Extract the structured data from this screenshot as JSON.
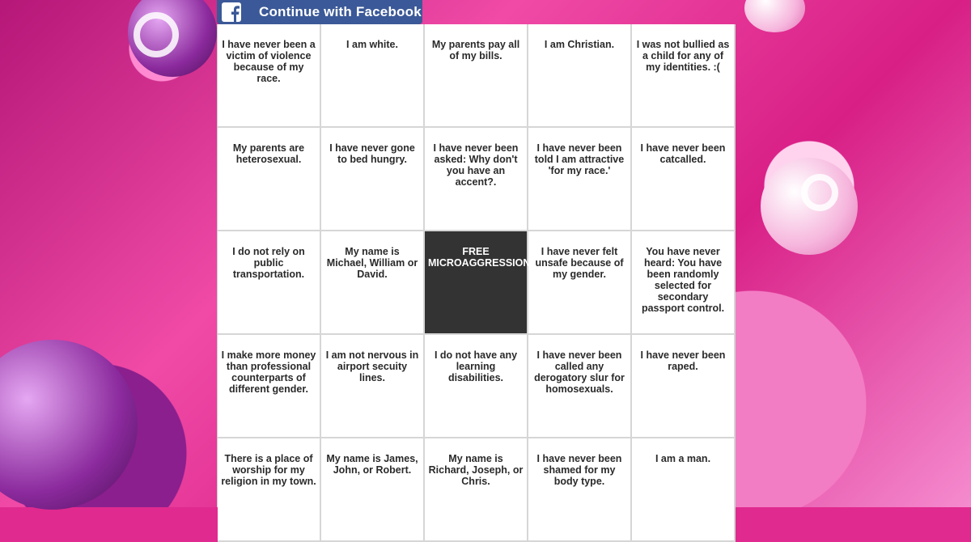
{
  "facebook": {
    "label": "Continue with Facebook"
  },
  "bingo": {
    "cells": [
      "I have never been a victim of violence because of my race.",
      "I am white.",
      "My parents pay all of my bills.",
      "I am Christian.",
      "I was not bullied as a child for any of my identities. :(",
      "My parents are heterosexual.",
      "I have never gone to bed hungry.",
      "I have never been asked: Why don't you have an accent?.",
      "I have never been told I am attractive 'for my race.'",
      "I have never been catcalled.",
      "I do not rely on public transportation.",
      "My name is Michael, William or David.",
      "FREE MICROAGGRESSION",
      "I have never felt unsafe because of my gender.",
      "You have never heard: You have been randomly selected for secondary passport control.",
      "I make more money than professional counterparts of different gender.",
      "I am not nervous in airport secuity lines.",
      "I do not have any learning disabilities.",
      "I have never been called any derogatory slur for homosexuals.",
      "I have never been raped.",
      "There is a place of worship for my religion in my town.",
      "My name is James, John, or Robert.",
      "My name is Richard, Joseph, or Chris.",
      "I have never been shamed for my body type.",
      "I am a man."
    ]
  },
  "colors": {
    "facebook": "#3b5998",
    "free_cell": "#333333",
    "background": "#e02a8f"
  }
}
